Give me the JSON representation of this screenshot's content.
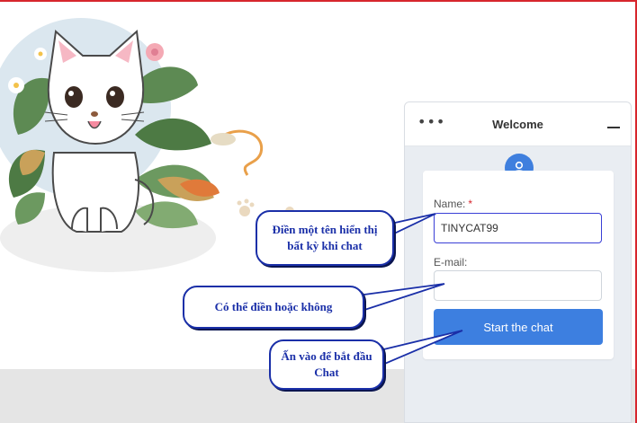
{
  "chat": {
    "title": "Welcome",
    "more_icon": "more-dots-icon",
    "minimize_icon": "minimize-icon",
    "avatar_icon": "user-icon",
    "name_label": "Name:",
    "name_required_mark": "*",
    "name_value": "TINYCAT99",
    "email_label": "E-mail:",
    "email_value": "",
    "start_button": "Start the chat",
    "accent_color": "#3d7fe0"
  },
  "callouts": {
    "name_hint": "Điền một tên hiển thị bất kỳ khi chat",
    "email_hint": "Có thể điền hoặc không",
    "start_hint": "Ấn vào để bắt đầu Chat"
  },
  "illustration": {
    "icon": "white-cat-illustration"
  }
}
